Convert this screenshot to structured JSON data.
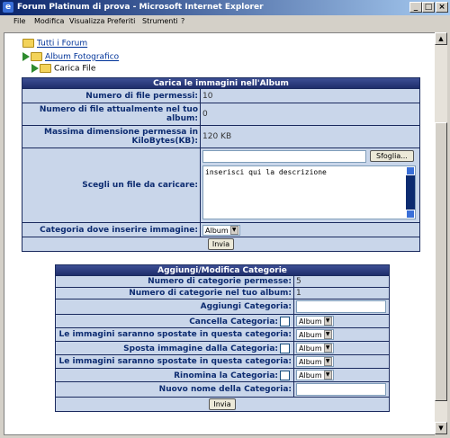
{
  "window": {
    "title": "Forum Platinum di prova - Microsoft Internet Explorer",
    "menu": [
      "File",
      "Modifica",
      "Visualizza",
      "Preferiti",
      "Strumenti",
      "?"
    ]
  },
  "breadcrumb": {
    "items": [
      "Tutti i Forum",
      "Album Fotografico",
      "Carica File"
    ]
  },
  "upload": {
    "title": "Carica le immagini nell'Album",
    "rows": [
      {
        "label": "Numero di file permessi:",
        "value": "10"
      },
      {
        "label": "Numero di file attualmente nel tuo album:",
        "value": "0"
      },
      {
        "label": "Massima dimensione permessa in KiloBytes(KB):",
        "value": "120 KB"
      }
    ],
    "file_label": "Scegli un file da caricare:",
    "browse_button": "Sfoglia...",
    "description_value": "inserisci qui la descrizione",
    "category_label": "Categoria dove inserire immagine:",
    "category_value": "Album",
    "submit": "Invia"
  },
  "categories": {
    "title": "Aggiungi/Modifica Categorie",
    "allowed_label": "Numero di categorie permesse:",
    "allowed_value": "5",
    "count_label": "Numero di categorie nel tuo album:",
    "count_value": "1",
    "add_label": "Aggiungi Categoria:",
    "delete_label": "Cancella Categoria:",
    "move_images_label": "Le immagini saranno spostate in questa categoria:",
    "move_cat_label": "Sposta immagine dalla Categoria:",
    "move_images_label2": "Le immagini saranno spostate in questa categoria:",
    "rename_label": "Rinomina la Categoria:",
    "newname_label": "Nuovo nome della Categoria:",
    "select_value": "Album",
    "submit": "Invia"
  }
}
